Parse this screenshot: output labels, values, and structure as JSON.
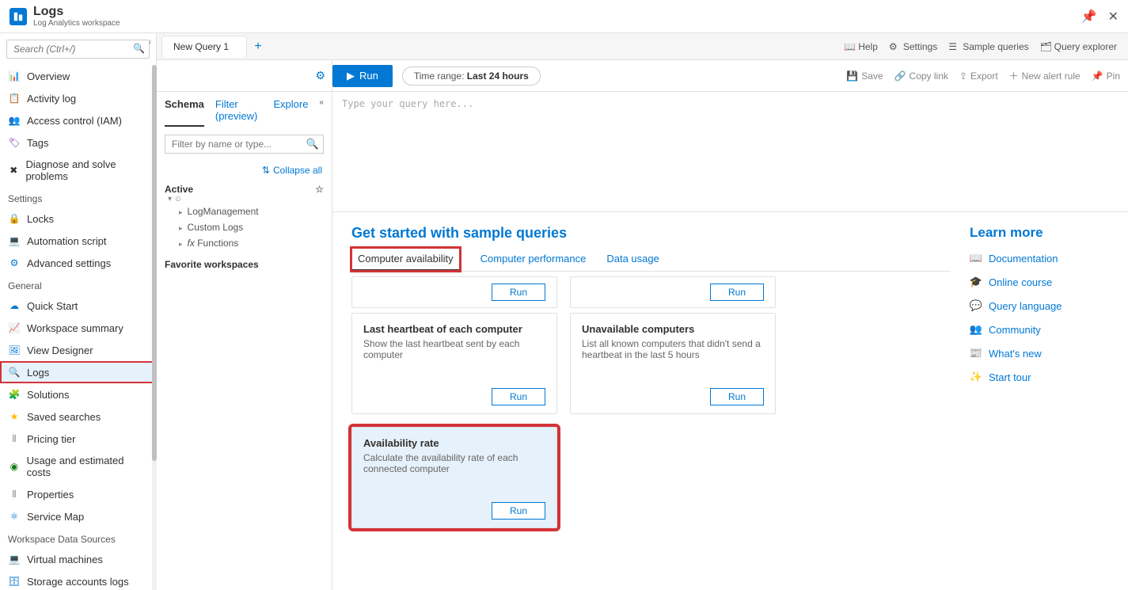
{
  "header": {
    "title": "Logs",
    "subtitle": "Log Analytics workspace"
  },
  "search_placeholder": "Search (Ctrl+/)",
  "sidebar": {
    "top_items": [
      {
        "icon": "📊",
        "label": "Overview",
        "color": "#0078d4"
      },
      {
        "icon": "📋",
        "label": "Activity log",
        "color": "#0078d4"
      },
      {
        "icon": "👥",
        "label": "Access control (IAM)",
        "color": "#0078d4"
      },
      {
        "icon": "🏷",
        "label": "Tags",
        "color": "#7b1fa2"
      },
      {
        "icon": "✖",
        "label": "Diagnose and solve problems",
        "color": "#323130"
      }
    ],
    "sections": [
      {
        "label": "Settings",
        "items": [
          {
            "icon": "🔒",
            "label": "Locks",
            "color": "#323130"
          },
          {
            "icon": "💻",
            "label": "Automation script",
            "color": "#0078d4"
          },
          {
            "icon": "⚙",
            "label": "Advanced settings",
            "color": "#0078d4"
          }
        ]
      },
      {
        "label": "General",
        "items": [
          {
            "icon": "☁",
            "label": "Quick Start",
            "color": "#0078d4"
          },
          {
            "icon": "📈",
            "label": "Workspace summary",
            "color": "#0078d4"
          },
          {
            "icon": "🖼",
            "label": "View Designer",
            "color": "#0078d4"
          },
          {
            "icon": "🔍",
            "label": "Logs",
            "color": "#0078d4",
            "active": true,
            "highlighted": true
          },
          {
            "icon": "🧩",
            "label": "Solutions",
            "color": "#ff8c00"
          },
          {
            "icon": "★",
            "label": "Saved searches",
            "color": "#ffb900"
          },
          {
            "icon": "⦀",
            "label": "Pricing tier",
            "color": "#888"
          },
          {
            "icon": "◉",
            "label": "Usage and estimated costs",
            "color": "#107c10"
          },
          {
            "icon": "⦀",
            "label": "Properties",
            "color": "#888"
          },
          {
            "icon": "⚛",
            "label": "Service Map",
            "color": "#0078d4"
          }
        ]
      },
      {
        "label": "Workspace Data Sources",
        "items": [
          {
            "icon": "💻",
            "label": "Virtual machines",
            "color": "#0078d4"
          },
          {
            "icon": "🗄",
            "label": "Storage accounts logs",
            "color": "#0078d4"
          }
        ]
      }
    ]
  },
  "tabs": {
    "items": [
      {
        "label": "New Query 1"
      }
    ]
  },
  "topbar_links": {
    "help": "Help",
    "settings": "Settings",
    "sample": "Sample queries",
    "explorer": "Query explorer"
  },
  "toolbar": {
    "run": "Run",
    "time_prefix": "Time range: ",
    "time_value": "Last 24 hours",
    "save": "Save",
    "copy": "Copy link",
    "export": "Export",
    "alert": "New alert rule",
    "pin": "Pin"
  },
  "schema": {
    "tabs": {
      "schema": "Schema",
      "filter": "Filter (preview)",
      "explore": "Explore"
    },
    "filter_placeholder": "Filter by name or type...",
    "collapse_all": "Collapse all",
    "active_label": "Active",
    "nodes": [
      "LogManagement",
      "Custom Logs",
      "Functions"
    ],
    "fav_label": "Favorite workspaces"
  },
  "query_placeholder": "Type your query here...",
  "samples": {
    "heading": "Get started with sample queries",
    "tabs": [
      "Computer availability",
      "Computer performance",
      "Data usage"
    ],
    "cards_row0": [
      {
        "run": "Run"
      },
      {
        "run": "Run"
      }
    ],
    "cards": [
      {
        "title": "Last heartbeat of each computer",
        "desc": "Show the last heartbeat sent by each computer",
        "run": "Run"
      },
      {
        "title": "Unavailable computers",
        "desc": "List all known computers that didn't send a heartbeat in the last 5 hours",
        "run": "Run"
      },
      {
        "title": "Availability rate",
        "desc": "Calculate the availability rate of each connected computer",
        "run": "Run",
        "highlighted": true
      }
    ]
  },
  "learn": {
    "heading": "Learn more",
    "links": [
      {
        "icon": "📖",
        "label": "Documentation"
      },
      {
        "icon": "🎓",
        "label": "Online course"
      },
      {
        "icon": "💬",
        "label": "Query language"
      },
      {
        "icon": "👥",
        "label": "Community"
      },
      {
        "icon": "📰",
        "label": "What's new"
      },
      {
        "icon": "✨",
        "label": "Start tour"
      }
    ]
  }
}
